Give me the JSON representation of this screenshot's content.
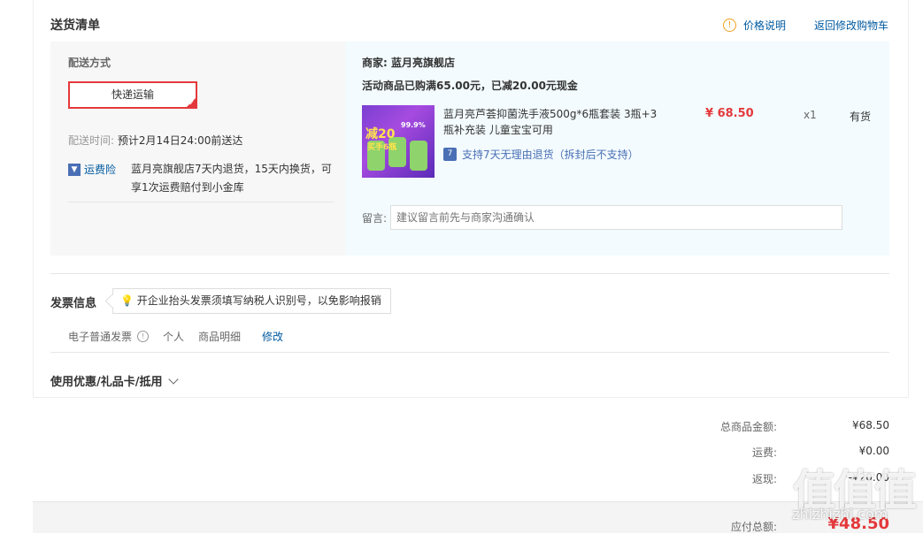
{
  "delivery": {
    "title": "送货清单",
    "price_note": "价格说明",
    "back_to_cart": "返回修改购物车",
    "method_label": "配送方式",
    "method_value": "快递运输",
    "time_label": "配送时间:",
    "time_value": "预计2月14日24:00前送达",
    "insurance_label": "运费险",
    "insurance_text": "蓝月亮旗舰店7天内退货，15天内换货，可享1次运费赔付到小金库"
  },
  "merchant": {
    "label": "商家:",
    "name": "蓝月亮旗舰店",
    "promo": "活动商品已购满65.00元，已减20.00元现金"
  },
  "product": {
    "name": "蓝月亮芦荟抑菌洗手液500g*6瓶套装 3瓶+3瓶补充装 儿童宝宝可用",
    "price": "¥ 68.50",
    "qty": "x1",
    "stock": "有货",
    "return_policy": "支持7天无理由退货（拆封后不支持）",
    "image_text_1": "99.9%",
    "image_text_2": "减20",
    "image_text_3": "买手6瓶"
  },
  "note": {
    "label": "留言:",
    "placeholder": "建议留言前先与商家沟通确认"
  },
  "invoice": {
    "title": "发票信息",
    "tip": "开企业抬头发票须填写纳税人识别号，以免影响报销",
    "type": "电子普通发票",
    "holder": "个人",
    "content": "商品明细",
    "edit": "修改"
  },
  "coupon": {
    "title": "使用优惠/礼品卡/抵用"
  },
  "summary": {
    "goods_label": "总商品金额:",
    "goods_value": "¥68.50",
    "shipping_label": "运费:",
    "shipping_value": "¥0.00",
    "rebate_label": "返现:",
    "rebate_value": "-¥20.00",
    "total_label": "应付总额:",
    "total_value": "¥48.50"
  },
  "watermark": {
    "main": "值值值",
    "sub": "zhizhizhi.com"
  },
  "colors": {
    "accent_red": "#e4393c",
    "link_blue": "#005aa0",
    "pane_blue": "#f3fbfe",
    "pane_gray": "#f7f7f7"
  }
}
